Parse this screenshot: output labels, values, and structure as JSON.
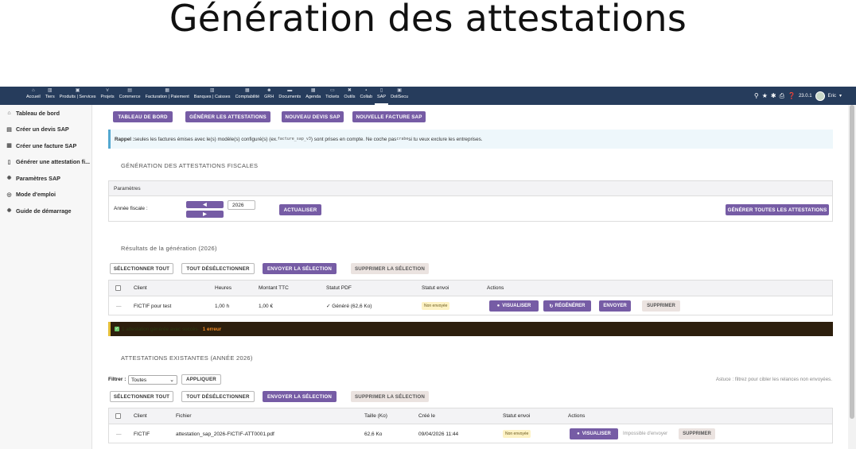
{
  "heading": "Génération des attestations",
  "topnav": [
    {
      "label": "Accueil",
      "icon": "home-icon"
    },
    {
      "label": "Tiers",
      "icon": "building-icon"
    },
    {
      "label": "Produits | Services",
      "icon": "box-icon"
    },
    {
      "label": "Projets",
      "icon": "project-icon"
    },
    {
      "label": "Commerce",
      "icon": "cart-icon"
    },
    {
      "label": "Facturation | Paiement",
      "icon": "invoice-icon"
    },
    {
      "label": "Banques | Caisses",
      "icon": "bank-icon"
    },
    {
      "label": "Comptabilité",
      "icon": "calculator-icon"
    },
    {
      "label": "GRH",
      "icon": "people-icon"
    },
    {
      "label": "Documents",
      "icon": "folder-icon"
    },
    {
      "label": "Agenda",
      "icon": "calendar-icon"
    },
    {
      "label": "Tickets",
      "icon": "ticket-icon"
    },
    {
      "label": "Outils",
      "icon": "tools-icon"
    },
    {
      "label": "Collab",
      "icon": "chat-icon"
    },
    {
      "label": "SAP",
      "icon": "document-icon"
    },
    {
      "label": "DoliSecu",
      "icon": "lock-icon"
    }
  ],
  "topbar": {
    "version": "23.0.1",
    "user": "Eric"
  },
  "sidebar": [
    {
      "label": "Tableau de bord",
      "icon": "home-icon"
    },
    {
      "label": "Créer un devis SAP",
      "icon": "quote-icon"
    },
    {
      "label": "Créer une facture SAP",
      "icon": "invoice-icon"
    },
    {
      "label": "Générer une attestation fi...",
      "icon": "document-icon"
    },
    {
      "label": "Paramètres SAP",
      "icon": "gear-icon"
    },
    {
      "label": "Mode d'emploi",
      "icon": "help-icon"
    },
    {
      "label": "Guide de démarrage",
      "icon": "gear-icon"
    }
  ],
  "toolbar": {
    "dashboard": "Tableau de bord",
    "generate": "Générer les attestations",
    "new_quote": "Nouveau devis SAP",
    "new_invoice": "Nouvelle facture SAP"
  },
  "info": {
    "label": "Rappel :",
    "text1": " seules les factures émises avec le(s) modèle(s) configuré(s) (ex. ",
    "code1": "facture_sap_v3",
    "text2": ") sont prises en compte. Ne coche pas ",
    "code2": "crabe",
    "text3": " si tu veux exclure les entreprises."
  },
  "generation": {
    "title": "Génération des attestations fiscales",
    "params_title": "Paramètres",
    "year_label": "Année fiscale :",
    "prev": "◀",
    "next": "▶",
    "year_value": "2026",
    "refresh": "Actualiser",
    "generate_all": "Générer toutes les attestations"
  },
  "results": {
    "title": "Résultats de la génération (2026)",
    "select_all": "Sélectionner tout",
    "deselect_all": "Tout désélectionner",
    "send_selection": "Envoyer la sélection",
    "delete_selection": "Supprimer la sélection",
    "columns": [
      "Client",
      "Heures",
      "Montant TTC",
      "Statut PDF",
      "Statut envoi",
      "Actions"
    ],
    "rows": [
      {
        "dash": "—",
        "client": "FICTIF pour test",
        "hours": "1,00 h",
        "amount": "1,00 €",
        "pdf_status": "✓ Généré (62,6 Ko)",
        "send_status": "Non envoyée",
        "view": "Visualiser",
        "regen": "Régénérer",
        "send": "Envoyer",
        "delete": "Supprimer"
      }
    ],
    "summary": {
      "success": "1 attestation générée avec succès",
      "sep": " · ",
      "error": "1 erreur"
    }
  },
  "existing": {
    "title": "Attestations existantes (année 2026)",
    "filter_label": "Filtrer :",
    "filter_value": "Toutes",
    "apply": "Appliquer",
    "tip": "Astuce : filtrez pour cibler les relances non envoyées.",
    "select_all": "Sélectionner tout",
    "deselect_all": "Tout désélectionner",
    "send_selection": "Envoyer la sélection",
    "delete_selection": "Supprimer la sélection",
    "columns": [
      "Client",
      "Fichier",
      "Taille (Ko)",
      "Créé le",
      "Statut envoi",
      "Actions"
    ],
    "rows": [
      {
        "dash": "—",
        "client": "FICTIF",
        "file": "attestation_sap_2026-FICTIF-ATT0001.pdf",
        "size": "62,6 Ko",
        "created": "09/04/2026 11:44",
        "send_status": "Non envoyée",
        "view": "Visualiser",
        "cannot_send": "Impossible d'envoyer",
        "delete": "Supprimer"
      }
    ]
  },
  "colors": {
    "topbar": "#263c5c",
    "accent": "#765ca5",
    "info_border": "#53a8d0",
    "warning_border": "#e3bd38"
  }
}
